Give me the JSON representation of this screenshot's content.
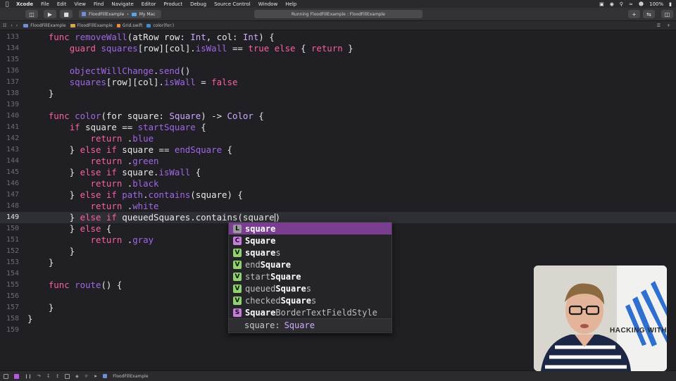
{
  "menubar": {
    "app": "Xcode",
    "items": [
      "File",
      "Edit",
      "View",
      "Find",
      "Navigate",
      "Editor",
      "Product",
      "Debug",
      "Source Control",
      "Window",
      "Help"
    ],
    "battery": "100%"
  },
  "toolbar": {
    "scheme_target": "FloodFillExample",
    "scheme_device": "My Mac",
    "status": "Running FloodFillExample : FloodFillExample"
  },
  "jumpbar": {
    "crumbs": [
      "FloodFillExample",
      "FloodFillExample",
      "Grid.swift",
      "color(for:)"
    ]
  },
  "editor": {
    "current_line": "149",
    "lines": [
      {
        "n": "133",
        "t": "    func removeWall(atRow row: Int, col: Int) {"
      },
      {
        "n": "134",
        "t": "        guard squares[row][col].isWall == true else { return }"
      },
      {
        "n": "135",
        "t": ""
      },
      {
        "n": "136",
        "t": "        objectWillChange.send()"
      },
      {
        "n": "137",
        "t": "        squares[row][col].isWall = false"
      },
      {
        "n": "138",
        "t": "    }"
      },
      {
        "n": "139",
        "t": ""
      },
      {
        "n": "140",
        "t": "    func color(for square: Square) -> Color {"
      },
      {
        "n": "141",
        "t": "        if square == startSquare {"
      },
      {
        "n": "142",
        "t": "            return .blue"
      },
      {
        "n": "143",
        "t": "        } else if square == endSquare {"
      },
      {
        "n": "144",
        "t": "            return .green"
      },
      {
        "n": "145",
        "t": "        } else if square.isWall {"
      },
      {
        "n": "146",
        "t": "            return .black"
      },
      {
        "n": "147",
        "t": "        } else if path.contains(square) {"
      },
      {
        "n": "148",
        "t": "            return .white"
      },
      {
        "n": "149",
        "t": "        } else if queuedSquares.contains(square)"
      },
      {
        "n": "150",
        "t": "        } else {"
      },
      {
        "n": "151",
        "t": "            return .gray"
      },
      {
        "n": "152",
        "t": "        }"
      },
      {
        "n": "153",
        "t": "    }"
      },
      {
        "n": "154",
        "t": ""
      },
      {
        "n": "155",
        "t": "    func route() {"
      },
      {
        "n": "156",
        "t": ""
      },
      {
        "n": "157",
        "t": "    }"
      },
      {
        "n": "158",
        "t": "}"
      },
      {
        "n": "159",
        "t": ""
      }
    ]
  },
  "autocomplete": {
    "items": [
      {
        "kind": "L",
        "match": "square",
        "rest": "",
        "pre": ""
      },
      {
        "kind": "C",
        "match": "Square",
        "rest": "",
        "pre": ""
      },
      {
        "kind": "V",
        "match": "square",
        "rest": "s",
        "pre": ""
      },
      {
        "kind": "V",
        "match": "Square",
        "rest": "",
        "pre": "end"
      },
      {
        "kind": "V",
        "match": "Square",
        "rest": "",
        "pre": "start"
      },
      {
        "kind": "V",
        "match": "Square",
        "rest": "s",
        "pre": "queued"
      },
      {
        "kind": "V",
        "match": "Square",
        "rest": "s",
        "pre": "checked"
      },
      {
        "kind": "S",
        "match": "Square",
        "rest": "BorderTextFieldStyle",
        "pre": ""
      }
    ],
    "footer_name": "square:",
    "footer_type": "Square",
    "badge_colors": {
      "L": "#9a9a9e",
      "C": "#c77bdb",
      "V": "#8fd36b",
      "S": "#c77bdb"
    }
  },
  "bottombar": {
    "target": "FloodFillExample"
  },
  "webcam": {
    "banner_text": "HACKING WITH S"
  }
}
